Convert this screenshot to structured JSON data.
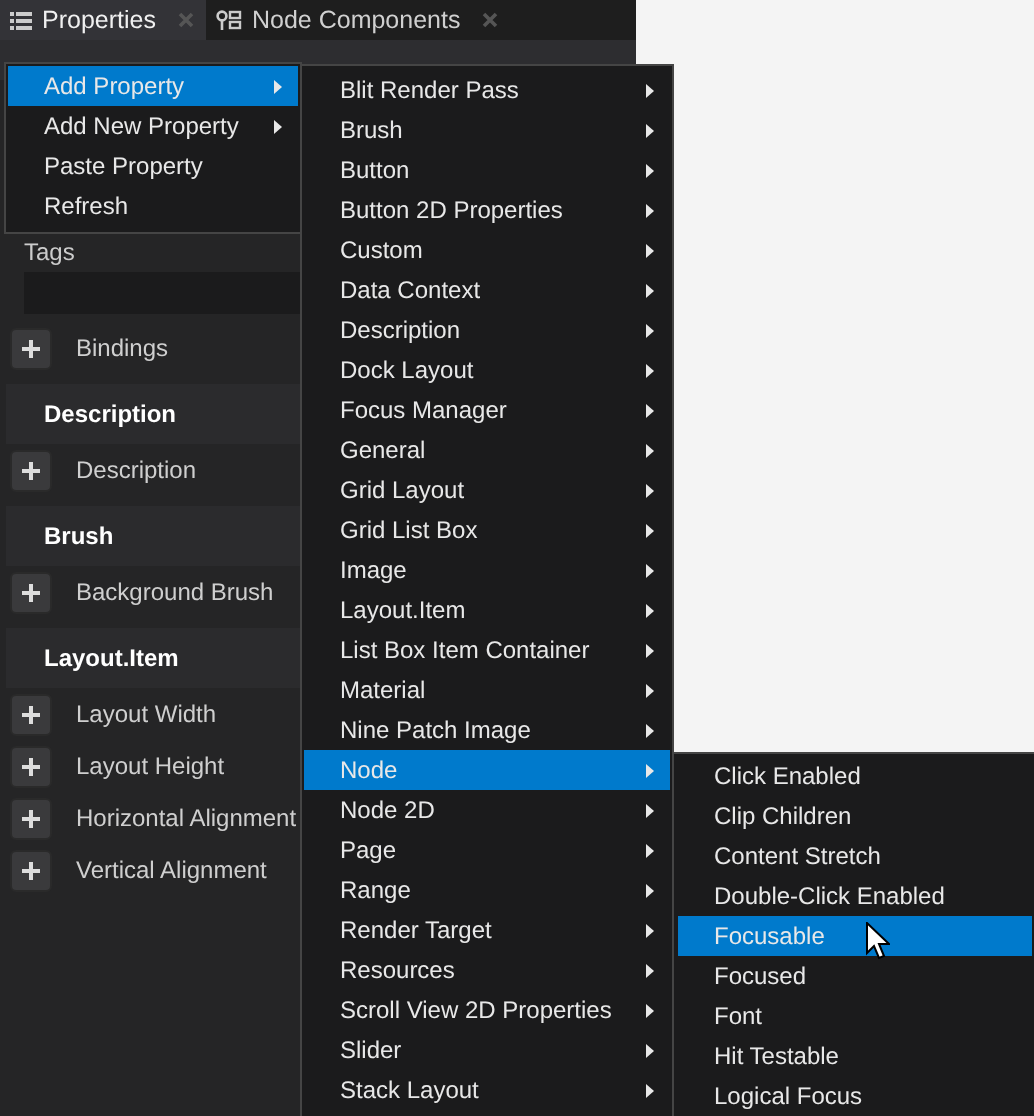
{
  "tabs": [
    {
      "label": "Properties",
      "kind": "list",
      "selected": true
    },
    {
      "label": "Node Components",
      "kind": "components",
      "selected": false
    }
  ],
  "panel": {
    "tags_label": "Tags",
    "rows": [
      {
        "kind": "property",
        "label": "Bindings"
      },
      {
        "kind": "header",
        "label": "Description"
      },
      {
        "kind": "property",
        "label": "Description"
      },
      {
        "kind": "header",
        "label": "Brush"
      },
      {
        "kind": "property",
        "label": "Background Brush"
      },
      {
        "kind": "header",
        "label": "Layout.Item"
      },
      {
        "kind": "property",
        "label": "Layout Width"
      },
      {
        "kind": "property",
        "label": "Layout Height"
      },
      {
        "kind": "property",
        "label": "Horizontal Alignment"
      },
      {
        "kind": "property",
        "label": "Vertical Alignment"
      }
    ]
  },
  "context_menu": [
    {
      "label": "Add Property",
      "submenu": true,
      "selected": true
    },
    {
      "label": "Add New Property",
      "submenu": true,
      "selected": false
    },
    {
      "label": "Paste Property",
      "submenu": false,
      "selected": false
    },
    {
      "label": "Refresh",
      "submenu": false,
      "selected": false
    }
  ],
  "submenu": [
    {
      "label": "Blit Render Pass",
      "submenu": true,
      "selected": false
    },
    {
      "label": "Brush",
      "submenu": true,
      "selected": false
    },
    {
      "label": "Button",
      "submenu": true,
      "selected": false
    },
    {
      "label": "Button 2D Properties",
      "submenu": true,
      "selected": false
    },
    {
      "label": "Custom",
      "submenu": true,
      "selected": false
    },
    {
      "label": "Data Context",
      "submenu": true,
      "selected": false
    },
    {
      "label": "Description",
      "submenu": true,
      "selected": false
    },
    {
      "label": "Dock Layout",
      "submenu": true,
      "selected": false
    },
    {
      "label": "Focus Manager",
      "submenu": true,
      "selected": false
    },
    {
      "label": "General",
      "submenu": true,
      "selected": false
    },
    {
      "label": "Grid Layout",
      "submenu": true,
      "selected": false
    },
    {
      "label": "Grid List Box",
      "submenu": true,
      "selected": false
    },
    {
      "label": "Image",
      "submenu": true,
      "selected": false
    },
    {
      "label": "Layout.Item",
      "submenu": true,
      "selected": false
    },
    {
      "label": "List Box Item Container",
      "submenu": true,
      "selected": false
    },
    {
      "label": "Material",
      "submenu": true,
      "selected": false
    },
    {
      "label": "Nine Patch Image",
      "submenu": true,
      "selected": false
    },
    {
      "label": "Node",
      "submenu": true,
      "selected": true
    },
    {
      "label": "Node 2D",
      "submenu": true,
      "selected": false
    },
    {
      "label": "Page",
      "submenu": true,
      "selected": false
    },
    {
      "label": "Range",
      "submenu": true,
      "selected": false
    },
    {
      "label": "Render Target",
      "submenu": true,
      "selected": false
    },
    {
      "label": "Resources",
      "submenu": true,
      "selected": false
    },
    {
      "label": "Scroll View 2D Properties",
      "submenu": true,
      "selected": false
    },
    {
      "label": "Slider",
      "submenu": true,
      "selected": false
    },
    {
      "label": "Stack Layout",
      "submenu": true,
      "selected": false
    }
  ],
  "node_submenu": [
    {
      "label": "Click Enabled",
      "submenu": false,
      "selected": false
    },
    {
      "label": "Clip Children",
      "submenu": false,
      "selected": false
    },
    {
      "label": "Content Stretch",
      "submenu": false,
      "selected": false
    },
    {
      "label": "Double-Click Enabled",
      "submenu": false,
      "selected": false
    },
    {
      "label": "Focusable",
      "submenu": false,
      "selected": true
    },
    {
      "label": "Focused",
      "submenu": false,
      "selected": false
    },
    {
      "label": "Font",
      "submenu": false,
      "selected": false
    },
    {
      "label": "Hit Testable",
      "submenu": false,
      "selected": false
    },
    {
      "label": "Logical Focus",
      "submenu": false,
      "selected": false
    }
  ]
}
